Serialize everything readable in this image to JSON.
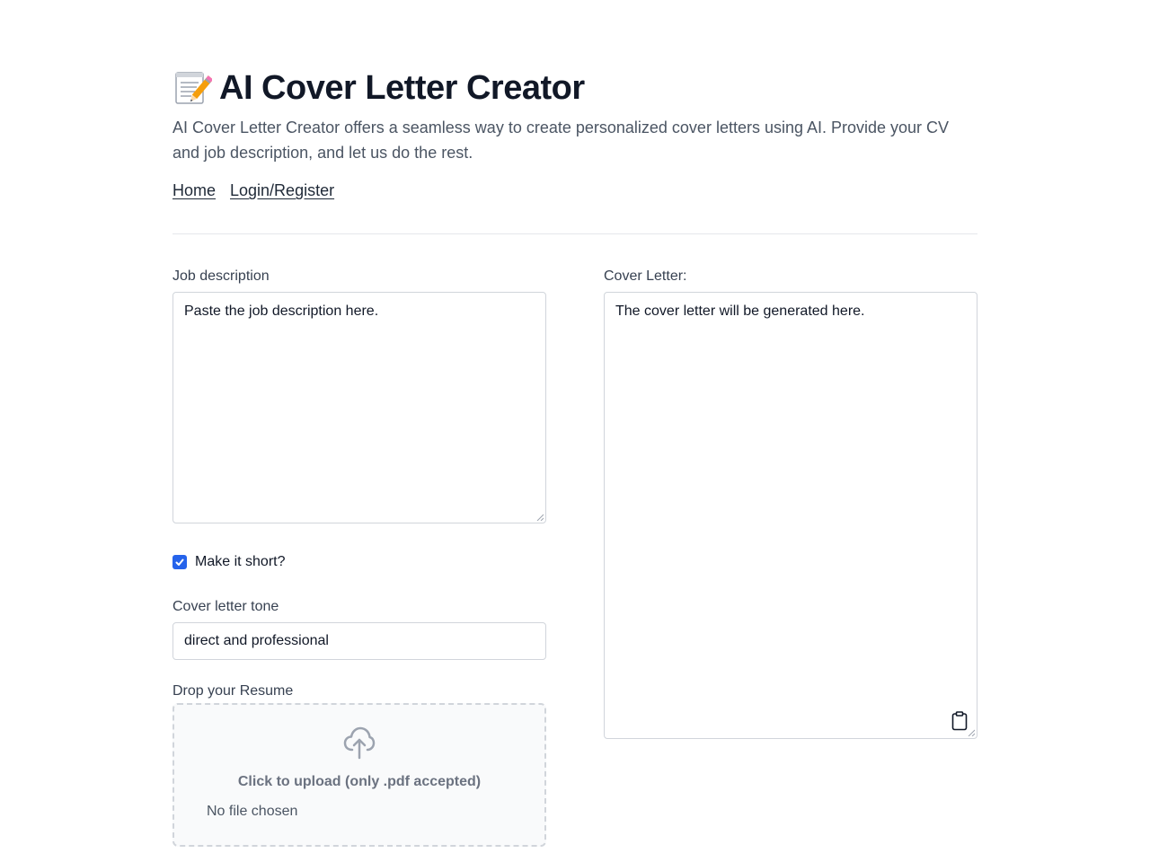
{
  "header": {
    "title_emoji": "📝",
    "title": "AI Cover Letter Creator",
    "subtitle": "AI Cover Letter Creator offers a seamless way to create personalized cover letters using AI. Provide your CV and job description, and let us do the rest."
  },
  "nav": {
    "home": "Home",
    "login": "Login/Register"
  },
  "form": {
    "job_description": {
      "label": "Job description",
      "placeholder": "Paste the job description here."
    },
    "short": {
      "label": "Make it short?",
      "checked": true
    },
    "tone": {
      "label": "Cover letter tone",
      "value": "direct and professional"
    },
    "resume": {
      "label": "Drop your Resume",
      "upload_text": "Click to upload (only .pdf accepted)",
      "file_status": "No file chosen"
    }
  },
  "output": {
    "label": "Cover Letter:",
    "placeholder": "The cover letter will be generated here."
  },
  "colors": {
    "accent": "#2563eb",
    "text": "#111827",
    "muted": "#4b5563",
    "border": "#d1d5db"
  }
}
